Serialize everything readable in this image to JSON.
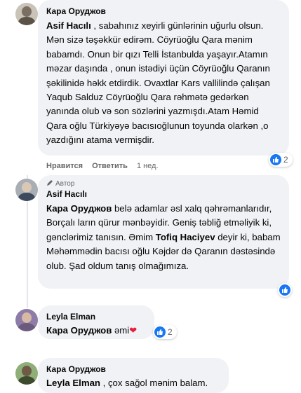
{
  "comments": [
    {
      "author": "Кара Оруджов",
      "mention": "Asif Hacılı",
      "text": " , sabahınız xeyirli günlərinin uğurlu olsun. Mən sizə təşəkkür edirəm. Cöyrüoğlu Qara mənim babamdı. Onun bir qızı Telli İstanbulda yaşayır.Atamın məzar daşında , onun istədiyi üçün Cöyrüoğlu Qaranın şəkilinidə həkk etdirdik. Ovaxtlar Kars vallilində çalışan Yaqub Salduz Cöyrüoğlu Qara rəhmətə gedərkən yanında olub və son sözlərini yazmışdı.Atam Həmid Qara oğlu Türkiyəyə bacısıoğlunun toyunda olarkən ,o yazdığını atama vermişdir.",
      "like_label": "Нравится",
      "reply_label": "Ответить",
      "time": "1 нед.",
      "reaction_count": "2"
    },
    {
      "author": "Asif Hacılı",
      "badge": "Автор",
      "mention": "Кара Оруджов",
      "text_1": " belə adamlar əsl xalq qəhrəmanlarıdır, Borçalı ların qürur mənbəyidir. Geniş təbliğ etməliyik ki, gənclərimiz tanısın. Əmim ",
      "mention_2": "Tofiq Haciyev",
      "text_2": " deyir ki, babam Məhəmmədin bacısı oğlu Kəjdər də Qaranın dəstəsində olub. Şad oldum tanış olmağımıza."
    },
    {
      "author": "Leyla Elman",
      "mention": "Кара Оруджов",
      "text": " əmi",
      "reaction_count": "2"
    },
    {
      "author": "Кара Оруджов",
      "mention": "Leyla Elman",
      "text": " , çox sağol mənim balam."
    }
  ],
  "colors": {
    "bubble": "#f0f2f5",
    "like_blue": "#1877f2",
    "meta": "#65676b",
    "heart": "#e41e3f"
  },
  "icons": [
    "like-icon",
    "heart-icon",
    "author-pen-icon"
  ]
}
